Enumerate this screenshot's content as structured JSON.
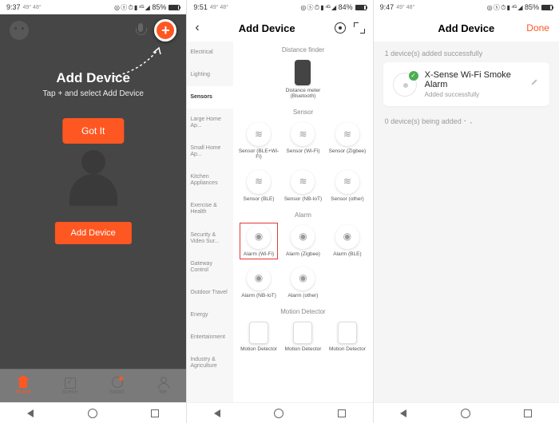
{
  "screen1": {
    "status": {
      "time": "9:37",
      "temp": "49° 48°",
      "battery": "85%"
    },
    "tooltip": {
      "title": "Add Device",
      "subtitle": "Tap + and select Add Device",
      "button": "Got It"
    },
    "add_device_btn": "Add Device",
    "tabs": {
      "home": "Home",
      "scene": "Scene",
      "smart": "Smart",
      "me": "Me"
    }
  },
  "screen2": {
    "status": {
      "time": "9:51",
      "temp": "49° 48°",
      "battery": "84%"
    },
    "header": {
      "title": "Add Device"
    },
    "categories": [
      "Electrical",
      "Lighting",
      "Sensors",
      "Large Home Ap...",
      "Small Home Ap...",
      "Kitchen Appliances",
      "Exercise & Health",
      "Security & Video Sur...",
      "Gateway Control",
      "Outdoor Travel",
      "Energy",
      "Entertainment",
      "Industry & Agriculture"
    ],
    "active_category": "Sensors",
    "section_distance": "Distance finder",
    "item_distance": "Distance meter (Bluetooth)",
    "section_sensor": "Sensor",
    "sensors_row1": [
      "Sensor (BLE+Wi-Fi)",
      "Sensor (Wi-Fi)",
      "Sensor (Zigbee)"
    ],
    "sensors_row2": [
      "Sensor (BLE)",
      "Sensor (NB-IoT)",
      "Sensor (other)"
    ],
    "section_alarm": "Alarm",
    "alarms_row1": [
      "Alarm (Wi-Fi)",
      "Alarm (Zigbee)",
      "Alarm (BLE)"
    ],
    "alarms_row2": [
      "Alarm (NB-IoT)",
      "Alarm (other)"
    ],
    "section_motion": "Motion Detector",
    "motion_row": [
      "Motion Detector",
      "Motion Detector",
      "Motion Detector"
    ]
  },
  "screen3": {
    "status": {
      "time": "9:47",
      "temp": "49° 48°",
      "battery": "85%"
    },
    "header": {
      "title": "Add Device",
      "done": "Done"
    },
    "success_header": "1 device(s) added successfully",
    "device": {
      "name": "X-Sense Wi-Fi Smoke Alarm",
      "status": "Added successfully"
    },
    "adding_header": "0 device(s) being added"
  }
}
